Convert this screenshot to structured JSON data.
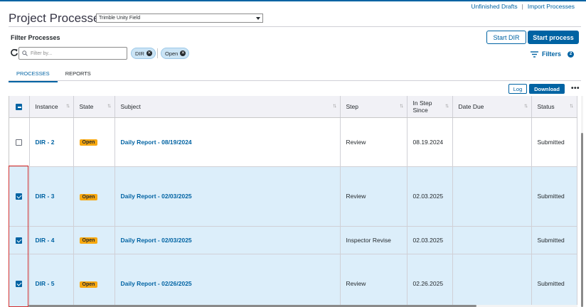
{
  "header": {
    "title": "Project Processes",
    "project_select": "Trimble Unity Field",
    "links": {
      "unfinished_drafts": "Unfinished Drafts",
      "separator": "|",
      "import_processes": "Import Processes"
    }
  },
  "filters": {
    "heading": "Filter Processes",
    "input_placeholder": "Filter by...",
    "chips": [
      "DIR",
      "Open"
    ],
    "filters_label": "Filters",
    "filters_count": "2"
  },
  "actions": {
    "start_dir": "Start DIR",
    "start_process": "Start process",
    "log": "Log",
    "download": "Download",
    "more": "•••"
  },
  "tabs": [
    "PROCESSES",
    "REPORTS"
  ],
  "table": {
    "columns": [
      "Instance",
      "State",
      "Subject",
      "Step",
      "In Step Since",
      "Date Due",
      "Status"
    ],
    "rows": [
      {
        "selected": false,
        "instance": "DIR - 2",
        "state": "Open",
        "subject": "Daily Report - 08/19/2024",
        "step": "Review",
        "in_step_since": "08.19.2024",
        "date_due": "",
        "status": "Submitted"
      },
      {
        "selected": true,
        "instance": "DIR - 3",
        "state": "Open",
        "subject": "Daily Report - 02/03/2025",
        "step": "Review",
        "in_step_since": "02.03.2025",
        "date_due": "",
        "status": "Submitted"
      },
      {
        "selected": true,
        "instance": "DIR - 4",
        "state": "Open",
        "subject": "Daily Report - 02/03/2025",
        "step": "Inspector Revise",
        "in_step_since": "02.03.2025",
        "date_due": "",
        "status": "Submitted"
      },
      {
        "selected": true,
        "instance": "DIR - 5",
        "state": "Open",
        "subject": "Daily Report - 02/26/2025",
        "step": "Review",
        "in_step_since": "02.26.2025",
        "date_due": "",
        "status": "Submitted"
      }
    ]
  },
  "colors": {
    "primary": "#0063a3",
    "selected_row": "#dceefa",
    "badge_open": "#f8a810",
    "highlight": "#d32f2f"
  }
}
